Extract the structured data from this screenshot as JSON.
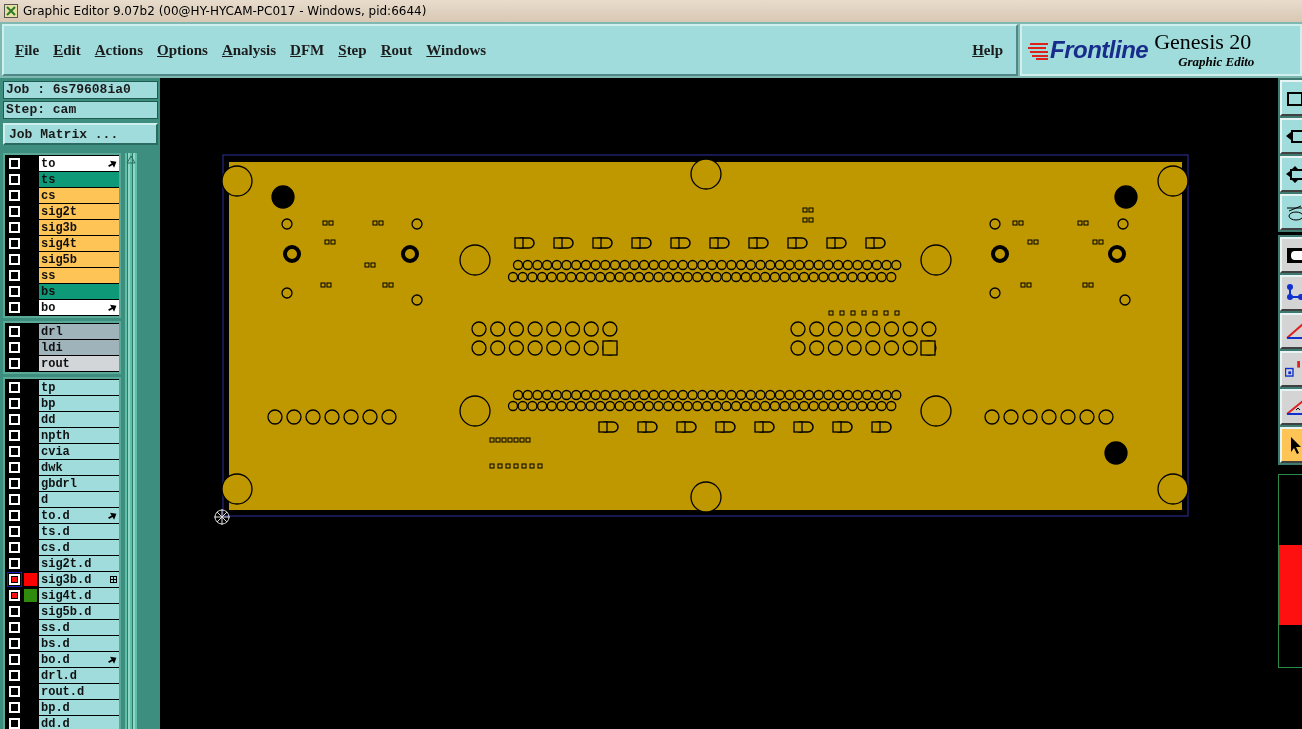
{
  "window": {
    "title": "Graphic Editor 9.07b2 (00@HY-HYCAM-PC017 - Windows, pid:6644)"
  },
  "menu": [
    "File",
    "Edit",
    "Actions",
    "Options",
    "Analysis",
    "DFM",
    "Step",
    "Rout",
    "Windows"
  ],
  "help": "Help",
  "brand": {
    "logo": "Frontline",
    "product": "Genesis 20",
    "subtitle": "Graphic Edito"
  },
  "job": {
    "job": "Job : 6s79608ia0",
    "step": "Step: cam",
    "matrix_button": "Job Matrix ..."
  },
  "layer_groups": [
    {
      "layers": [
        {
          "name": "to",
          "color": "#ffffff",
          "pointer": true,
          "affected": false,
          "selected": false
        },
        {
          "name": "ts",
          "color": "#0e9a78",
          "affected": false,
          "selected": false
        },
        {
          "name": "cs",
          "color": "#ffc456",
          "affected": false,
          "selected": false
        },
        {
          "name": "sig2t",
          "color": "#ffc456",
          "affected": false,
          "selected": false
        },
        {
          "name": "sig3b",
          "color": "#ffc456",
          "affected": false,
          "selected": false
        },
        {
          "name": "sig4t",
          "color": "#ffc456",
          "affected": false,
          "selected": false
        },
        {
          "name": "sig5b",
          "color": "#ffc456",
          "affected": false,
          "selected": false
        },
        {
          "name": "ss",
          "color": "#ffc456",
          "affected": false,
          "selected": false
        },
        {
          "name": "bs",
          "color": "#0e9a78",
          "affected": false,
          "selected": false
        },
        {
          "name": "bo",
          "color": "#ffffff",
          "pointer": true,
          "affected": false,
          "selected": false
        }
      ]
    },
    {
      "layers": [
        {
          "name": "drl",
          "color": "#9fb3bb",
          "affected": false,
          "selected": false
        },
        {
          "name": "ldi",
          "color": "#9fb3bb",
          "affected": false,
          "selected": false
        },
        {
          "name": "rout",
          "color": "#d2d6d8",
          "affected": false,
          "selected": false
        }
      ]
    },
    {
      "layers": [
        {
          "name": "tp",
          "color": "#a0dcdc",
          "affected": false,
          "selected": false
        },
        {
          "name": "bp",
          "color": "#a0dcdc",
          "affected": false,
          "selected": false
        },
        {
          "name": "dd",
          "color": "#a0dcdc",
          "affected": false,
          "selected": false
        },
        {
          "name": "npth",
          "color": "#a0dcdc",
          "affected": false,
          "selected": false
        },
        {
          "name": "cvia",
          "color": "#a0dcdc",
          "affected": false,
          "selected": false
        },
        {
          "name": "dwk",
          "color": "#a0dcdc",
          "affected": false,
          "selected": false
        },
        {
          "name": "gbdrl",
          "color": "#a0dcdc",
          "affected": false,
          "selected": false
        },
        {
          "name": "d",
          "color": "#a0dcdc",
          "affected": false,
          "selected": false
        },
        {
          "name": "to.d",
          "color": "#a0dcdc",
          "pointer": true,
          "affected": false,
          "selected": false
        },
        {
          "name": "ts.d",
          "color": "#a0dcdc",
          "affected": false,
          "selected": false
        },
        {
          "name": "cs.d",
          "color": "#a0dcdc",
          "affected": false,
          "selected": false
        },
        {
          "name": "sig2t.d",
          "color": "#a0dcdc",
          "affected": false,
          "selected": false
        },
        {
          "name": "sig3b.d",
          "color": "#a0dcdc",
          "grid": true,
          "affected": true,
          "selected": true,
          "swatch": {
            "color": "#ff0000"
          }
        },
        {
          "name": "sig4t.d",
          "color": "#a0dcdc",
          "affected": true,
          "selected": false,
          "swatch": {
            "color": "#2e8b0e"
          }
        },
        {
          "name": "sig5b.d",
          "color": "#a0dcdc",
          "affected": false,
          "selected": false
        },
        {
          "name": "ss.d",
          "color": "#a0dcdc",
          "affected": false,
          "selected": false
        },
        {
          "name": "bs.d",
          "color": "#a0dcdc",
          "affected": false,
          "selected": false
        },
        {
          "name": "bo.d",
          "color": "#a0dcdc",
          "pointer": true,
          "affected": false,
          "selected": false
        },
        {
          "name": "drl.d",
          "color": "#a0dcdc",
          "affected": false,
          "selected": false
        },
        {
          "name": "rout.d",
          "color": "#a0dcdc",
          "affected": false,
          "selected": false
        },
        {
          "name": "bp.d",
          "color": "#a0dcdc",
          "affected": false,
          "selected": false
        },
        {
          "name": "dd.d",
          "color": "#a0dcdc",
          "affected": false,
          "selected": false
        }
      ]
    }
  ],
  "edit_tools": [
    {
      "selected": false
    },
    {
      "selected": false
    },
    {
      "selected": false
    },
    {
      "selected": false
    },
    {
      "selected": false
    },
    {
      "selected": true
    }
  ]
}
